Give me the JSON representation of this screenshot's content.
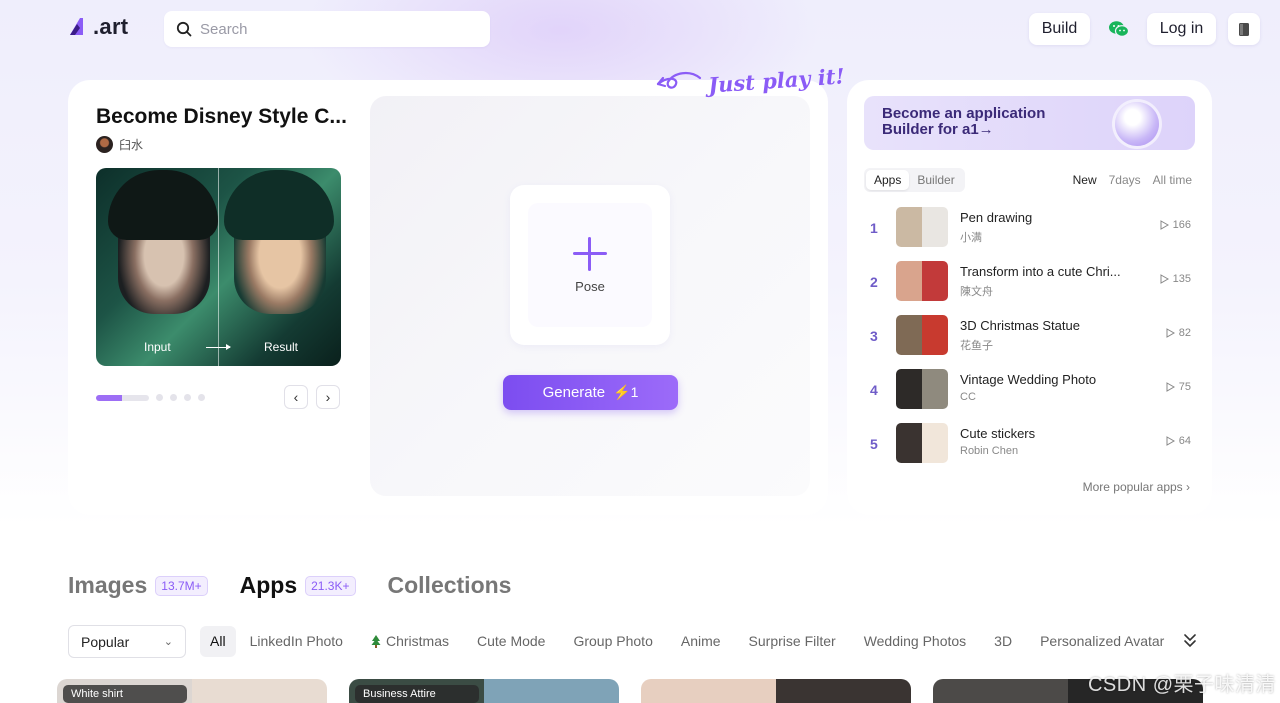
{
  "header": {
    "logo_text": ".art",
    "search_placeholder": "Search",
    "build_label": "Build",
    "login_label": "Log in"
  },
  "hero": {
    "title": "Become Disney Style C...",
    "author": "臼水",
    "preview_input_label": "Input",
    "preview_result_label": "Result",
    "pose_label": "Pose",
    "generate_label": "Generate",
    "generate_cost": "⚡1",
    "hint": "Just play it!",
    "carousel_active_index": 0,
    "carousel_count": 5
  },
  "sidebar": {
    "banner_text": "Become an application Builder for a1→",
    "tabs": [
      {
        "label": "Apps",
        "active": true
      },
      {
        "label": "Builder",
        "active": false
      }
    ],
    "periods": [
      {
        "label": "New",
        "active": true
      },
      {
        "label": "7days",
        "active": false
      },
      {
        "label": "All time",
        "active": false
      }
    ],
    "ranking": [
      {
        "rank": "1",
        "name": "Pen drawing",
        "author": "小满",
        "plays": "166",
        "colors": [
          "#cbb9a3",
          "#e9e6e2"
        ]
      },
      {
        "rank": "2",
        "name": "Transform into a cute Chri...",
        "author": "陳文舟",
        "plays": "135",
        "colors": [
          "#d9a48d",
          "#c23a3a"
        ]
      },
      {
        "rank": "3",
        "name": "3D Christmas Statue",
        "author": "花鱼子",
        "plays": "82",
        "colors": [
          "#7f6a55",
          "#c83a2f"
        ]
      },
      {
        "rank": "4",
        "name": "Vintage Wedding Photo",
        "author": "CC",
        "plays": "75",
        "colors": [
          "#2d2a28",
          "#8f8a7e"
        ]
      },
      {
        "rank": "5",
        "name": "Cute stickers",
        "author": "Robin Chen",
        "plays": "64",
        "colors": [
          "#3a3330",
          "#f1e6da"
        ]
      }
    ],
    "more_label": "More popular apps ›"
  },
  "sections": [
    {
      "label": "Images",
      "badge": "13.7M+",
      "active": false
    },
    {
      "label": "Apps",
      "badge": "21.3K+",
      "active": true
    },
    {
      "label": "Collections",
      "badge": "",
      "active": false
    }
  ],
  "filters": {
    "sort_value": "Popular",
    "chips": [
      {
        "label": "All",
        "active": true,
        "icon": ""
      },
      {
        "label": "LinkedIn Photo",
        "active": false,
        "icon": ""
      },
      {
        "label": "Christmas",
        "active": false,
        "icon": "tree-icon"
      },
      {
        "label": "Cute Mode",
        "active": false,
        "icon": ""
      },
      {
        "label": "Group Photo",
        "active": false,
        "icon": ""
      },
      {
        "label": "Anime",
        "active": false,
        "icon": ""
      },
      {
        "label": "Surprise Filter",
        "active": false,
        "icon": ""
      },
      {
        "label": "Wedding Photos",
        "active": false,
        "icon": ""
      },
      {
        "label": "3D",
        "active": false,
        "icon": ""
      },
      {
        "label": "Personalized Avatar",
        "active": false,
        "icon": ""
      }
    ]
  },
  "cards": [
    {
      "label": "White shirt",
      "colors": [
        "#dcd6d2",
        "#e8dcd2"
      ]
    },
    {
      "label": "Business Attire",
      "colors": [
        "#3b4c44",
        "#7fa3b7"
      ]
    },
    {
      "label": "",
      "colors": [
        "#e7cfc0",
        "#3a3432"
      ]
    },
    {
      "label": "",
      "colors": [
        "#4c4a48",
        "#262626"
      ]
    }
  ],
  "watermark": "CSDN @栗子味清清",
  "colors": {
    "accent": "#8b5cf6",
    "rank_number": "#6f5cc8",
    "wechat": "#19b55b"
  }
}
